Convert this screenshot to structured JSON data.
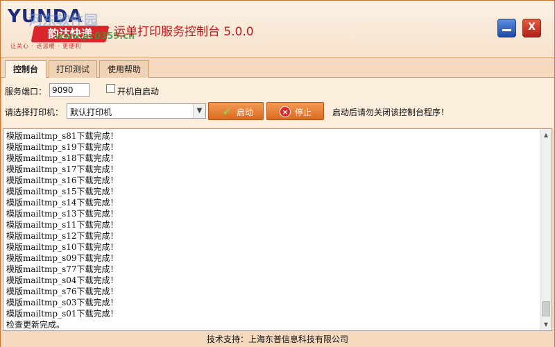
{
  "header": {
    "logo_text": "YUNDA",
    "logo_cn": "韵达快递",
    "logo_slogan": "让关心 · 送温暖 · 更便利",
    "watermark": "河东软件园",
    "watermark_url": "www.pc0359.cn",
    "title": "运单打印服务控制台 5.0.0",
    "close_label": "X"
  },
  "tabs": [
    {
      "label": "控制台"
    },
    {
      "label": "打印测试"
    },
    {
      "label": "使用帮助"
    }
  ],
  "settings": {
    "port_label": "服务端口：",
    "port_value": "9090",
    "autostart_label": "开机自启动",
    "printer_label": "请选择打印机：",
    "printer_value": "默认打印机",
    "start_label": "启动",
    "stop_label": "停止",
    "hint": "启动后请勿关闭该控制台程序！"
  },
  "log": [
    "模版mailtmp_s81下载完成！",
    "模版mailtmp_s19下载完成！",
    "模版mailtmp_s18下载完成！",
    "模版mailtmp_s17下载完成！",
    "模版mailtmp_s16下载完成！",
    "模版mailtmp_s15下载完成！",
    "模版mailtmp_s14下载完成！",
    "模版mailtmp_s13下载完成！",
    "模版mailtmp_s11下载完成！",
    "模版mailtmp_s12下载完成！",
    "模版mailtmp_s10下载完成！",
    "模版mailtmp_s09下载完成！",
    "模版mailtmp_s77下载完成！",
    "模版mailtmp_s04下载完成！",
    "模版mailtmp_s76下载完成！",
    "模版mailtmp_s03下载完成！",
    "模版mailtmp_s01下载完成！",
    "检查更新完成。"
  ],
  "footer": {
    "support": "技术支持：上海东普信息科技有限公司"
  },
  "colors": {
    "accent": "#e07a2c",
    "title_red": "#c4161c",
    "panel_bg": "#fbeedd"
  }
}
